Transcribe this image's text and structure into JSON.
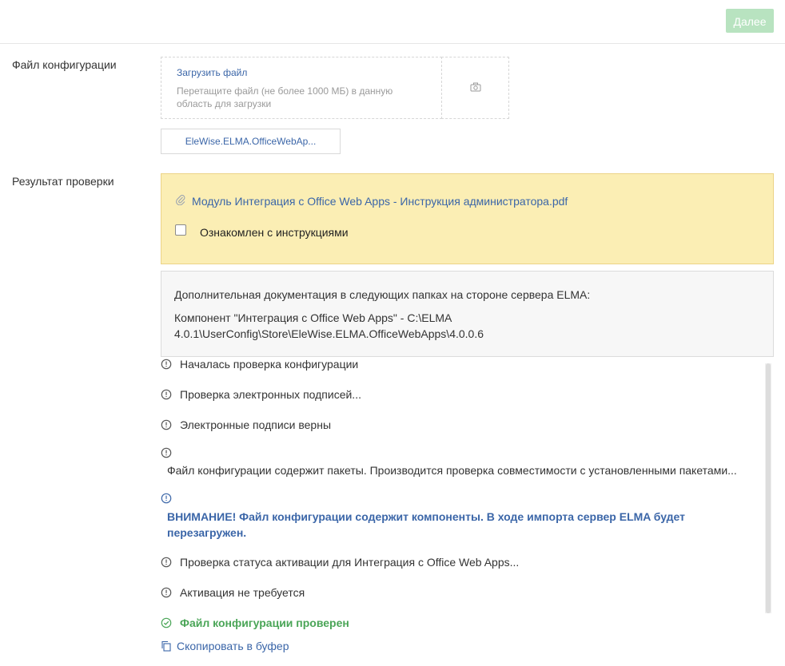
{
  "header": {
    "next_label": "Далее"
  },
  "config_file": {
    "label": "Файл конфигурации",
    "upload_link": "Загрузить файл",
    "upload_hint": "Перетащите файл (не более 1000 МБ) в данную область для загрузки",
    "camera_icon": "camera-icon",
    "file_name": "EleWise.ELMA.OfficeWebAp..."
  },
  "check_result": {
    "label": "Результат проверки",
    "warning_box": {
      "doc_icon": "paperclip-icon",
      "doc_link": "Модуль Интеграция с Office Web Apps - Инструкция администратора.pdf",
      "checkbox_label": "Ознакомлен с инструкциями",
      "checked": false
    },
    "info_box": {
      "line1": "Дополнительная документация в следующих папках на стороне сервера ELMA:",
      "line2": "Компонент \"Интеграция с Office Web Apps\" - C:\\ELMA 4.0.1\\UserConfig\\Store\\EleWise.ELMA.OfficeWebApps\\4.0.0.6"
    },
    "log": [
      {
        "icon": "info-circle-icon",
        "text": "Началась проверка конфигурации"
      },
      {
        "icon": "info-circle-icon",
        "text": "Проверка электронных подписей..."
      },
      {
        "icon": "info-circle-icon",
        "text": "Электронные подписи верны"
      },
      {
        "icon": "info-circle-icon",
        "text": "Файл конфигурации содержит пакеты. Производится проверка совместимости с установленными пакетами..."
      },
      {
        "icon": "alert-circle-icon",
        "text": "ВНИМАНИЕ! Файл конфигурации содержит компоненты. В ходе импорта сервер ELMA будет перезагружен."
      },
      {
        "icon": "info-circle-icon",
        "text": "Проверка статуса активации для Интеграция с Office Web Apps..."
      },
      {
        "icon": "info-circle-icon",
        "text": "Активация не требуется"
      }
    ],
    "success": {
      "icon": "check-circle-icon",
      "text": "Файл конфигурации проверен"
    },
    "copy": {
      "icon": "copy-icon",
      "text": "Скопировать в буфер"
    }
  },
  "colors": {
    "link": "#3b66a8",
    "success": "#4aa557",
    "next_button": "#b8e3c0",
    "warning_bg": "#fbeeb4"
  }
}
